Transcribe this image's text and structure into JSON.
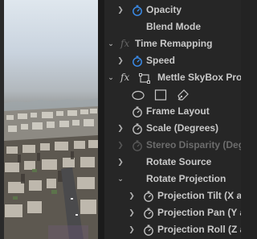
{
  "colors": {
    "panel_bg": "#262626",
    "text": "#c9c9c9",
    "dim_text": "#6c6c6c",
    "stopwatch_active": "#3b8ff0",
    "stopwatch_idle": "#c7c7c7"
  },
  "effect_controls": {
    "rows": [
      {
        "label": "Opacity",
        "caret": "right",
        "icon": "stopwatch-icon-active"
      },
      {
        "label": "Blend Mode",
        "caret": "none",
        "icon": "none"
      },
      {
        "label": "Time Remapping",
        "caret": "down",
        "icon": "fx-icon"
      },
      {
        "label": "Speed",
        "caret": "right",
        "icon": "stopwatch-icon-active"
      },
      {
        "label": "Mettle SkyBox Projections",
        "caret": "down",
        "icon": "fx-icon"
      },
      {
        "label": "",
        "caret": "none",
        "icon": "mask-tools"
      },
      {
        "label": "Frame Layout",
        "caret": "none",
        "icon": "stopwatch-icon"
      },
      {
        "label": "Scale (Degrees)",
        "caret": "right",
        "icon": "stopwatch-icon"
      },
      {
        "label": "Stereo Disparity (Degrees)",
        "caret": "right",
        "icon": "stopwatch-icon-disabled"
      },
      {
        "label": "Rotate Source",
        "caret": "right",
        "icon": "none"
      },
      {
        "label": "Rotate Projection",
        "caret": "down",
        "icon": "none"
      },
      {
        "label": "Projection Tilt (X axis)",
        "caret": "right",
        "icon": "stopwatch-icon"
      },
      {
        "label": "Projection Pan (Y axis)",
        "caret": "right",
        "icon": "stopwatch-icon"
      },
      {
        "label": "Projection Roll (Z axis)",
        "caret": "right",
        "icon": "stopwatch-icon"
      }
    ]
  }
}
